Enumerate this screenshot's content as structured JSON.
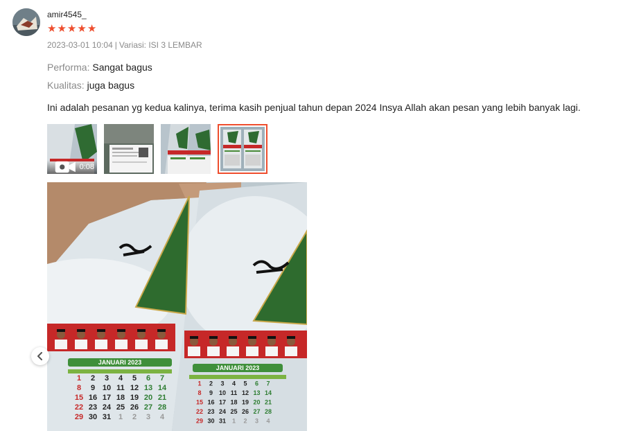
{
  "review": {
    "username": "amir4545_",
    "rating": 5,
    "date": "2023-03-01 10:04",
    "separator": "|",
    "variation_label": "Variasi:",
    "variation_value": "ISI 3 LEMBAR",
    "performance_label": "Performa:",
    "performance_value": "Sangat bagus",
    "quality_label": "Kualitas:",
    "quality_value": "juga bagus",
    "comment": "Ini adalah pesanan yg kedua kalinya, terima kasih penjual tahun depan 2024 Insya Allah akan pesan yang lebih banyak lagi."
  },
  "media": {
    "video_duration": "0:08",
    "active_index": 3,
    "calendar_month": "JANUARI 2023"
  },
  "colors": {
    "star": "#ee4d2d",
    "active_border": "#ee4d2d",
    "calendar_green": "#2e7d32",
    "calendar_red": "#c62828"
  },
  "icons": [
    "star-icon",
    "video-camera-icon",
    "chevron-left-icon"
  ]
}
